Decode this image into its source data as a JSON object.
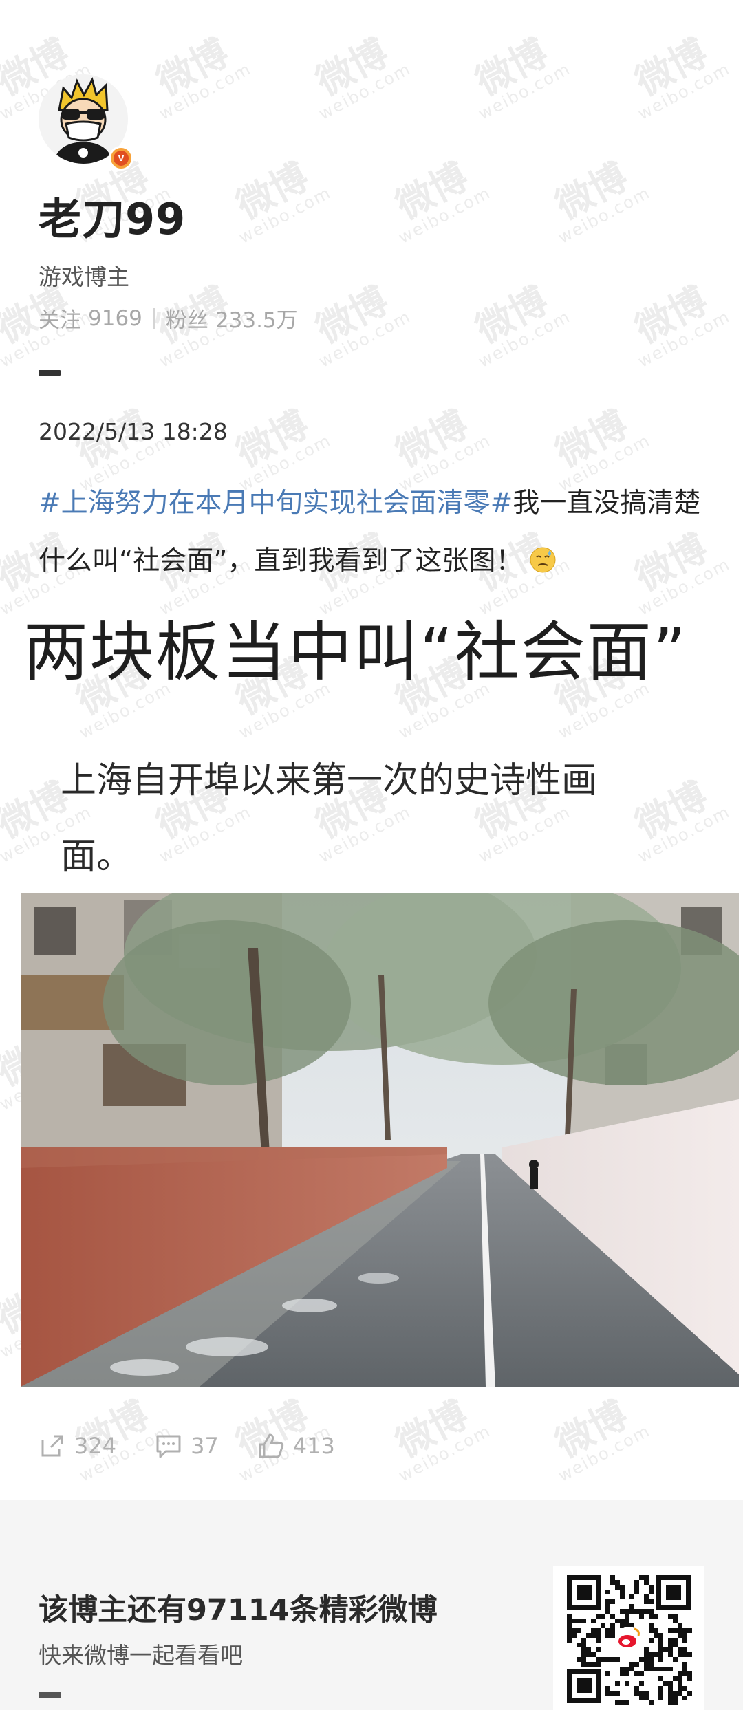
{
  "profile": {
    "username": "老刀99",
    "subtitle": "游戏博主",
    "following_label": "关注",
    "following_count": "9169",
    "followers_label": "粉丝",
    "followers_count": "233.5万",
    "verified_badge_letter": "v",
    "badge_color": "#f7a23a"
  },
  "post": {
    "timestamp": "2022/5/13 18:28",
    "hashtag": "#上海努力在本月中旬实现社会面清零#",
    "text": "我一直没搞清楚什么叫“社会面”，直到我看到了这张图！",
    "emoji_icon": "sweat-emoji-icon",
    "hashtag_color": "#4a7ab5"
  },
  "image": {
    "heading": "两块板当中叫“社会面”",
    "caption": "上海自开埠以来第一次的史诗性画面。"
  },
  "actions": {
    "repost_icon": "share-icon",
    "repost_count": "324",
    "comment_icon": "comment-icon",
    "comment_count": "37",
    "like_icon": "thumbs-up-icon",
    "like_count": "413"
  },
  "footer": {
    "title": "该博主还有97114条精彩微博",
    "subtitle": "快来微博一起看看吧"
  },
  "watermark": {
    "cn": "微博",
    "en": "weibo.com"
  }
}
